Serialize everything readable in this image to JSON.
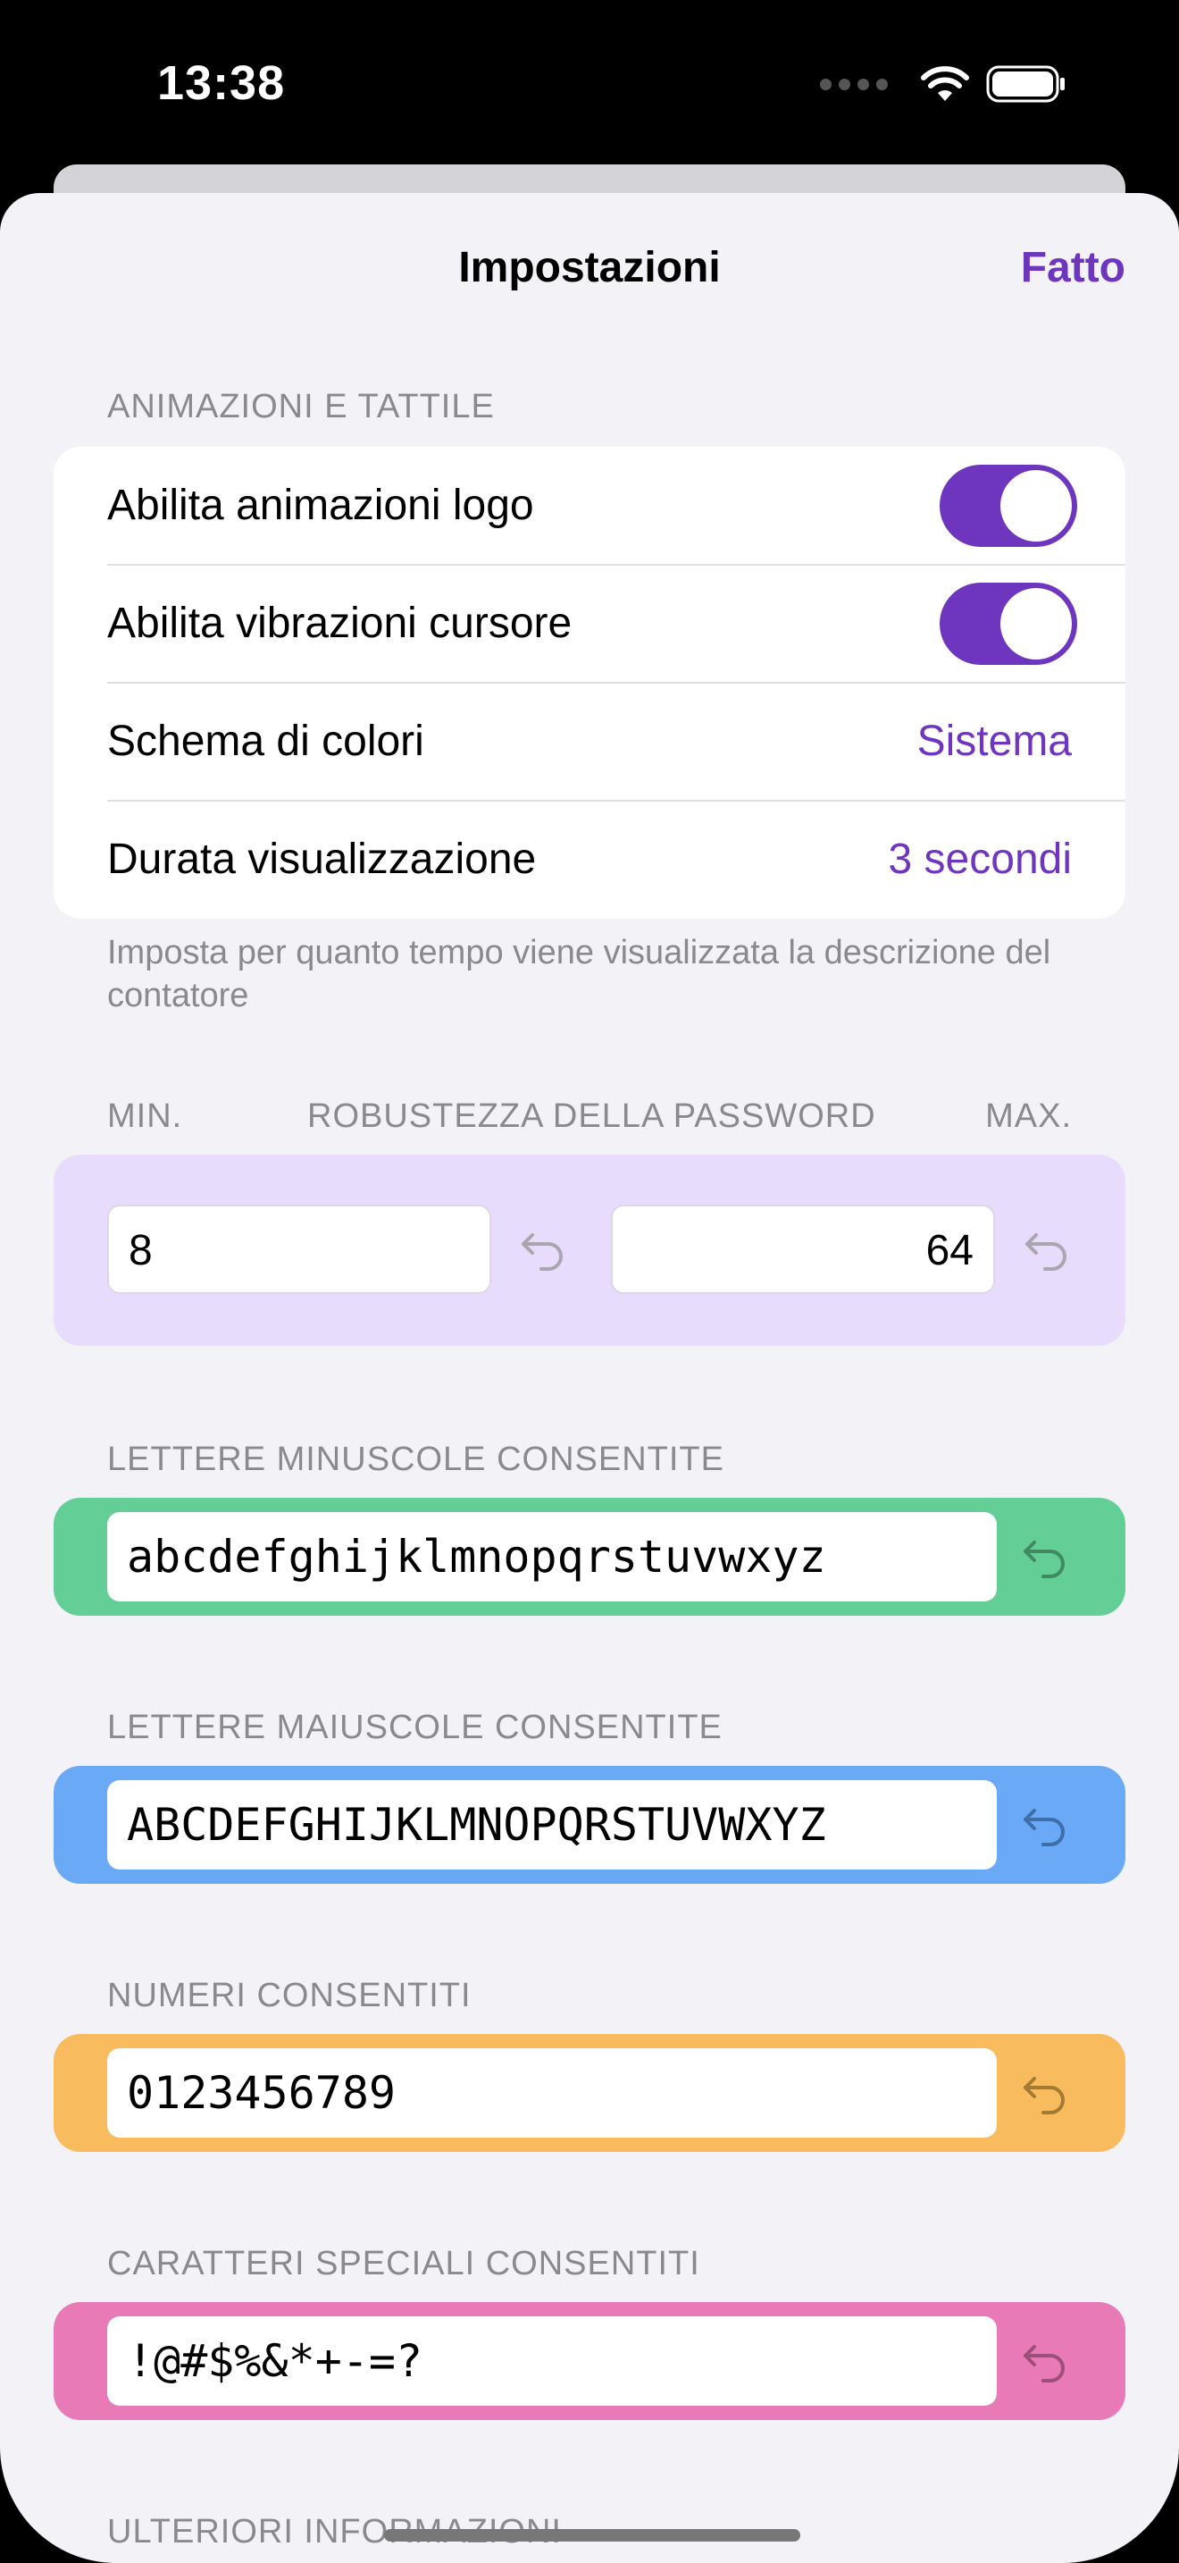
{
  "status": {
    "time": "13:38"
  },
  "nav": {
    "title": "Impostazioni",
    "done": "Fatto"
  },
  "animations": {
    "header": "ANIMAZIONI E TATTILE",
    "logo_animations": {
      "label": "Abilita animazioni logo",
      "on": true
    },
    "cursor_vibrations": {
      "label": "Abilita vibrazioni cursore",
      "on": true
    },
    "color_scheme": {
      "label": "Schema di colori",
      "value": "Sistema"
    },
    "display_duration": {
      "label": "Durata visualizzazione",
      "value": "3 secondi"
    },
    "footer": "Imposta per quanto tempo viene visualizzata la descrizione del contatore"
  },
  "strength": {
    "min_label": "MIN.",
    "header": "ROBUSTEZZA DELLA PASSWORD",
    "max_label": "MAX.",
    "min_value": "8",
    "max_value": "64"
  },
  "lowercase": {
    "header": "LETTERE MINUSCOLE CONSENTITE",
    "value": "abcdefghijklmnopqrstuvwxyz",
    "color": "#63cf97"
  },
  "uppercase": {
    "header": "LETTERE MAIUSCOLE CONSENTITE",
    "value": "ABCDEFGHIJKLMNOPQRSTUVWXYZ",
    "color": "#69a9f6"
  },
  "numbers": {
    "header": "NUMERI CONSENTITI",
    "value": "0123456789",
    "color": "#f8bb5e"
  },
  "special": {
    "header": "CARATTERI SPECIALI CONSENTITI",
    "value": "!@#$%&*+-=?",
    "color": "#e87ab7"
  },
  "more_info": {
    "header": "ULTERIORI INFORMAZIONI"
  },
  "colors": {
    "accent": "#6e35bf",
    "strength_bg": "#e7dcfb"
  }
}
